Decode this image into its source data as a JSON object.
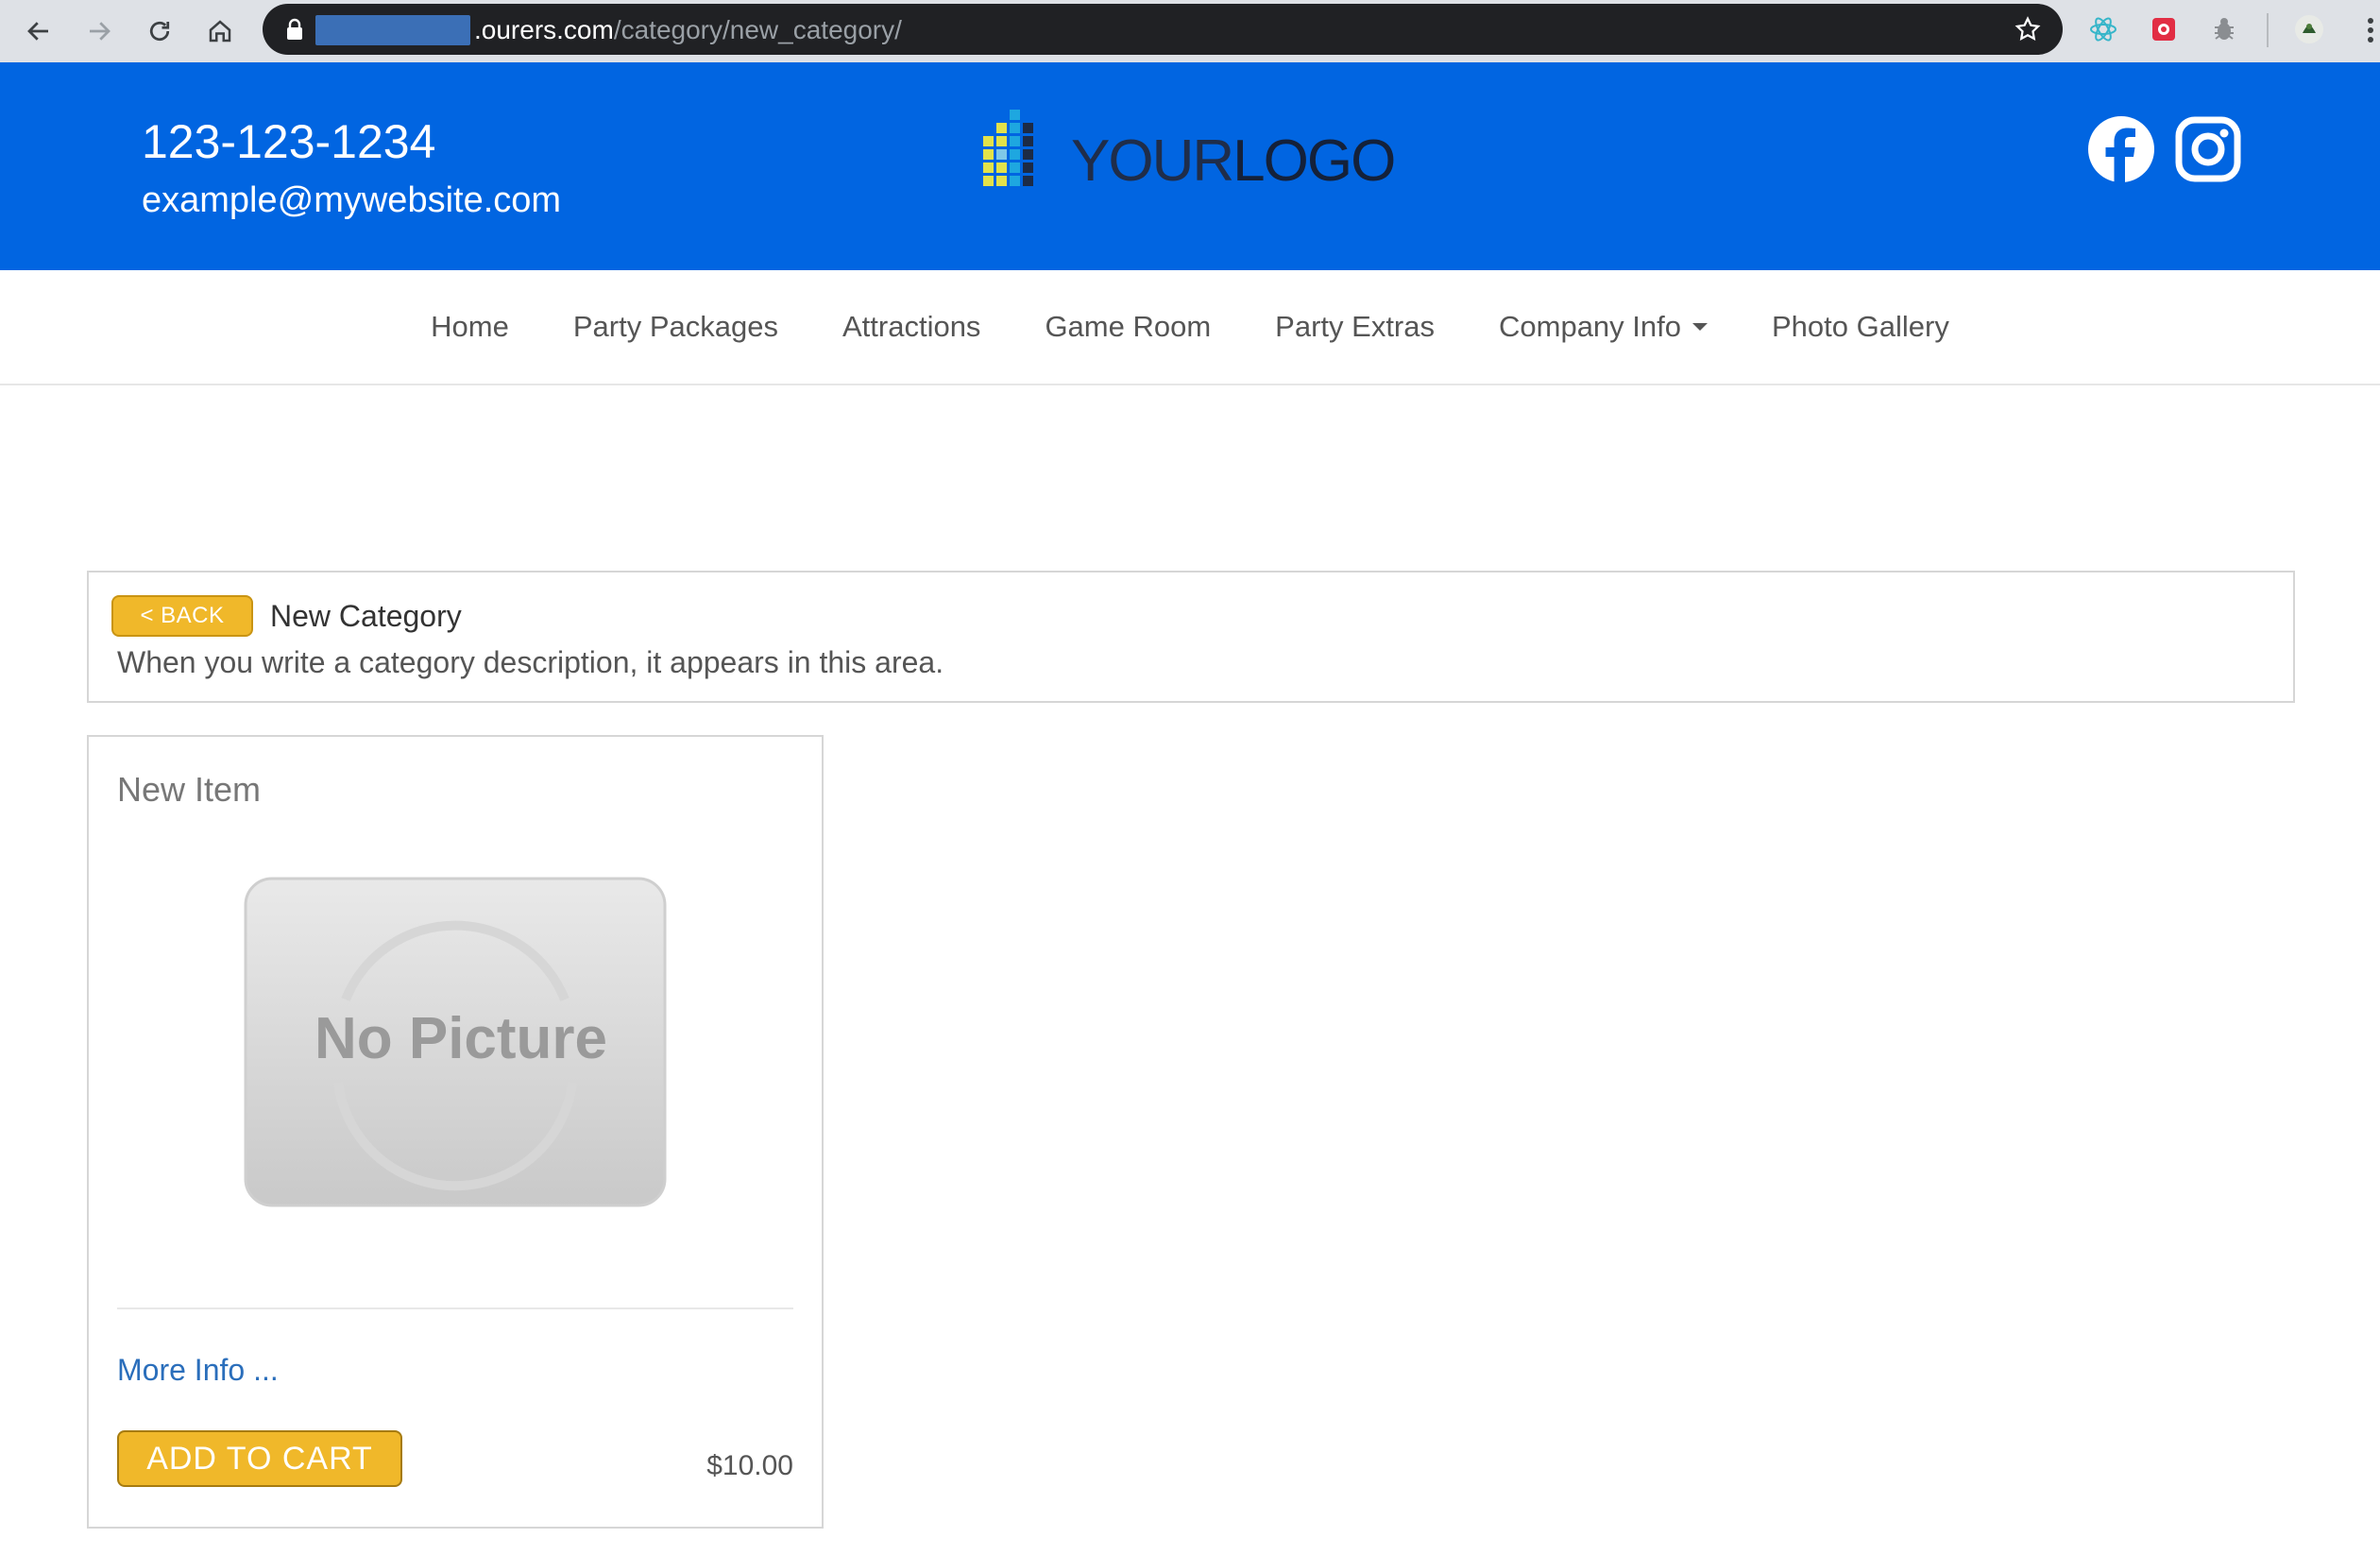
{
  "browser": {
    "url_host": ".ourers.com",
    "url_path": "/category/new_category/"
  },
  "header": {
    "phone": "123-123-1234",
    "email": "example@mywebsite.com",
    "logo_word_1": "YOUR",
    "logo_word_2": "LOGO"
  },
  "nav": {
    "items": [
      {
        "label": "Home"
      },
      {
        "label": "Party Packages"
      },
      {
        "label": "Attractions"
      },
      {
        "label": "Game Room"
      },
      {
        "label": "Party Extras"
      },
      {
        "label": "Company Info"
      },
      {
        "label": "Photo Gallery"
      }
    ]
  },
  "category": {
    "back_label": "< BACK",
    "title": "New Category",
    "description": "When you write a category description, it appears in this area."
  },
  "product": {
    "title": "New Item",
    "image_placeholder": "No Picture",
    "more_info": "More Info ...",
    "add_to_cart": "ADD TO CART",
    "price": "$10.00"
  },
  "colors": {
    "header_blue": "#0165e1",
    "button_yellow": "#f0b82a",
    "link_blue": "#2a6ebb"
  }
}
